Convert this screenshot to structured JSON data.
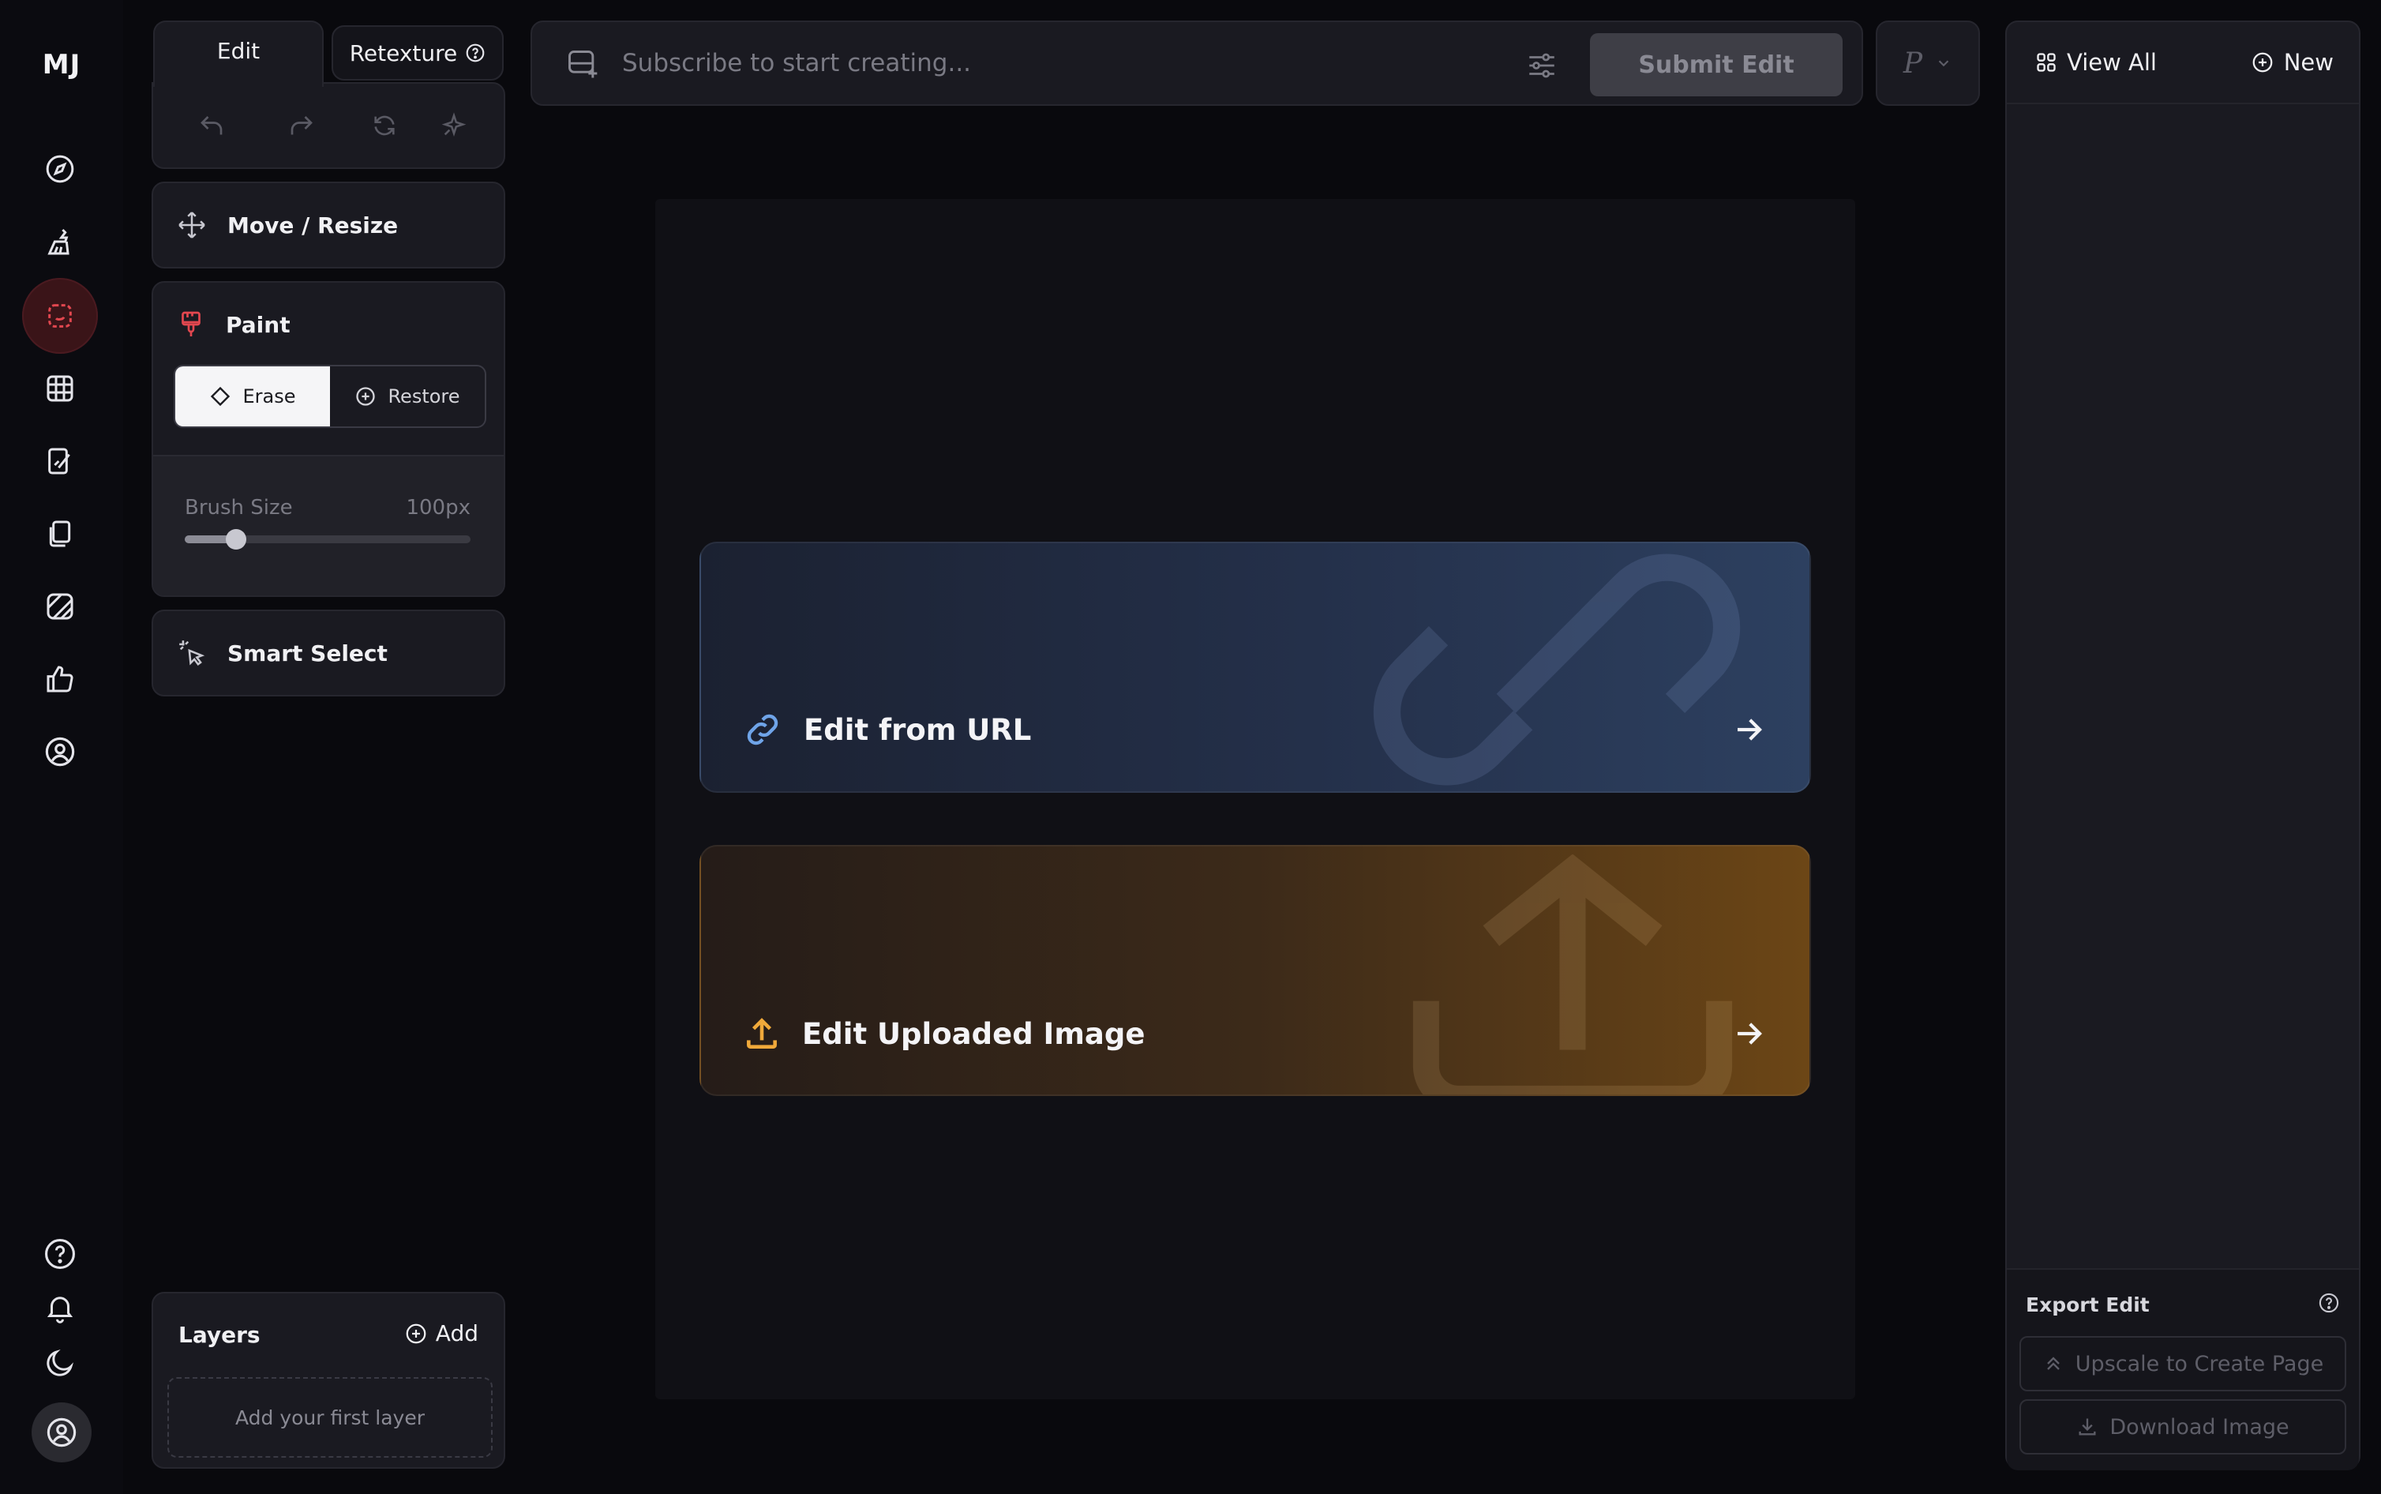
{
  "rail": {
    "logo": "MJ",
    "items": [
      "explore-icon",
      "create-icon",
      "edit-icon",
      "organize-icon",
      "personalize-icon",
      "moodboards-icon",
      "styles-icon",
      "rate-icon",
      "account-icon"
    ],
    "active_item": "edit-icon",
    "bottom": [
      "help-icon",
      "notifications-icon",
      "dark-mode-icon",
      "profile-avatar"
    ]
  },
  "tools": {
    "tab_edit": "Edit",
    "tab_retexture": "Retexture",
    "move_resize": "Move / Resize",
    "paint": "Paint",
    "erase": "Erase",
    "restore": "Restore",
    "brush_size_label": "Brush Size",
    "brush_size_value": "100px",
    "brush_size_fraction": 0.18,
    "smart_select": "Smart Select"
  },
  "layers": {
    "title": "Layers",
    "add": "Add",
    "empty": "Add your first layer"
  },
  "prompt": {
    "placeholder": "Subscribe to start creating...",
    "submit": "Submit Edit",
    "version": "P"
  },
  "canvas": {
    "edit_url": "Edit from URL",
    "edit_upload": "Edit Uploaded Image"
  },
  "right": {
    "view_all": "View All",
    "new": "New",
    "export_title": "Export Edit",
    "upscale": "Upscale to Create Page",
    "download": "Download Image"
  },
  "colors": {
    "accent_red": "#e2474f",
    "url_icon": "#6fa4e8",
    "upload_icon": "#f0a93a"
  }
}
